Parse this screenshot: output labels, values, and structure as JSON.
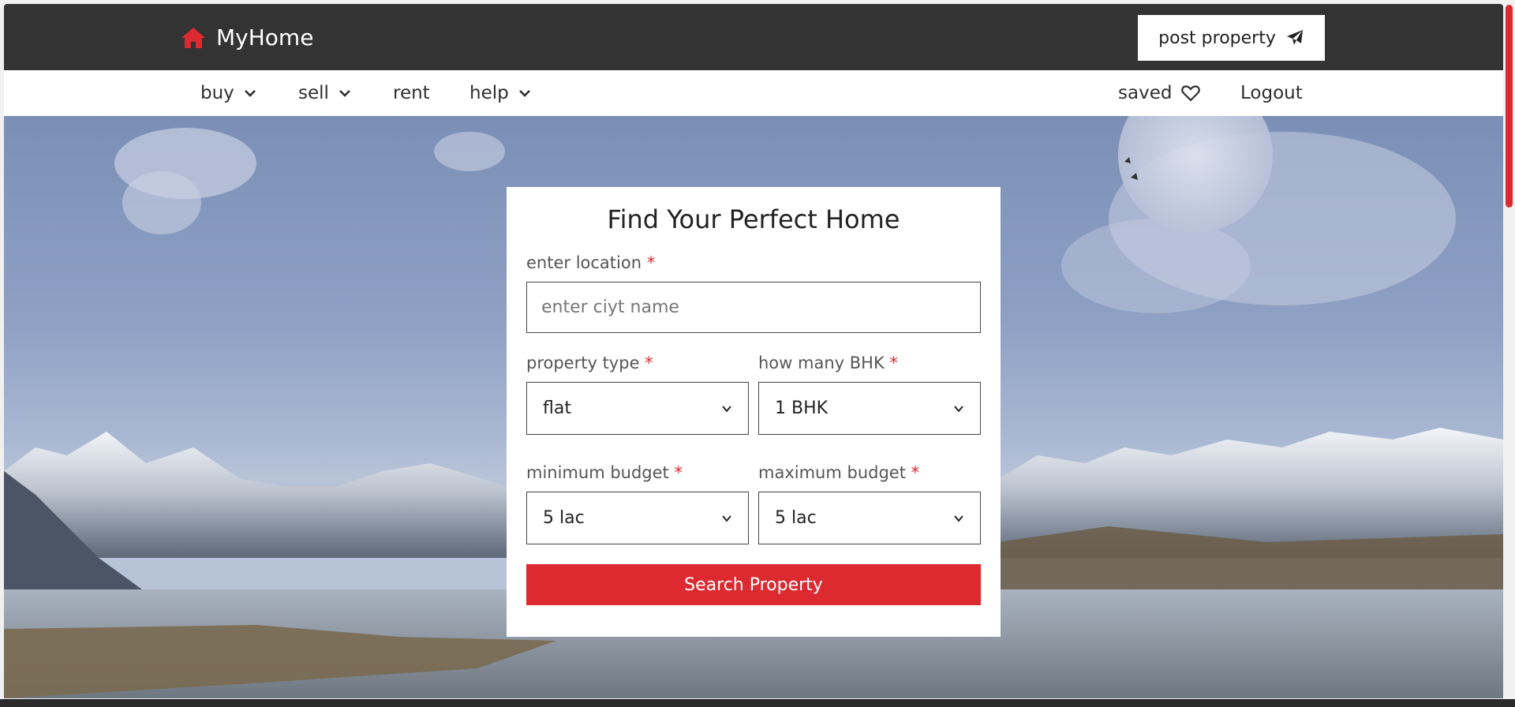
{
  "brand": {
    "name": "MyHome",
    "icon": "home-icon"
  },
  "header": {
    "post_property_label": "post property",
    "post_icon": "paper-plane-icon"
  },
  "nav": {
    "buy": "buy",
    "sell": "sell",
    "rent": "rent",
    "help": "help",
    "saved": "saved",
    "logout": "Logout"
  },
  "search_form": {
    "title": "Find Your Perfect Home",
    "location_label": "enter location",
    "location_placeholder": "enter ciyt name",
    "property_type_label": "property type",
    "property_type_value": "flat",
    "bhk_label": "how many BHK",
    "bhk_value": "1 BHK",
    "min_budget_label": "minimum budget",
    "min_budget_value": "5 lac",
    "max_budget_label": "maximum budget",
    "max_budget_value": "5 lac",
    "required_marker": "*",
    "submit_label": "Search Property"
  },
  "colors": {
    "accent": "#dc2a30",
    "header_bg": "#333333"
  }
}
